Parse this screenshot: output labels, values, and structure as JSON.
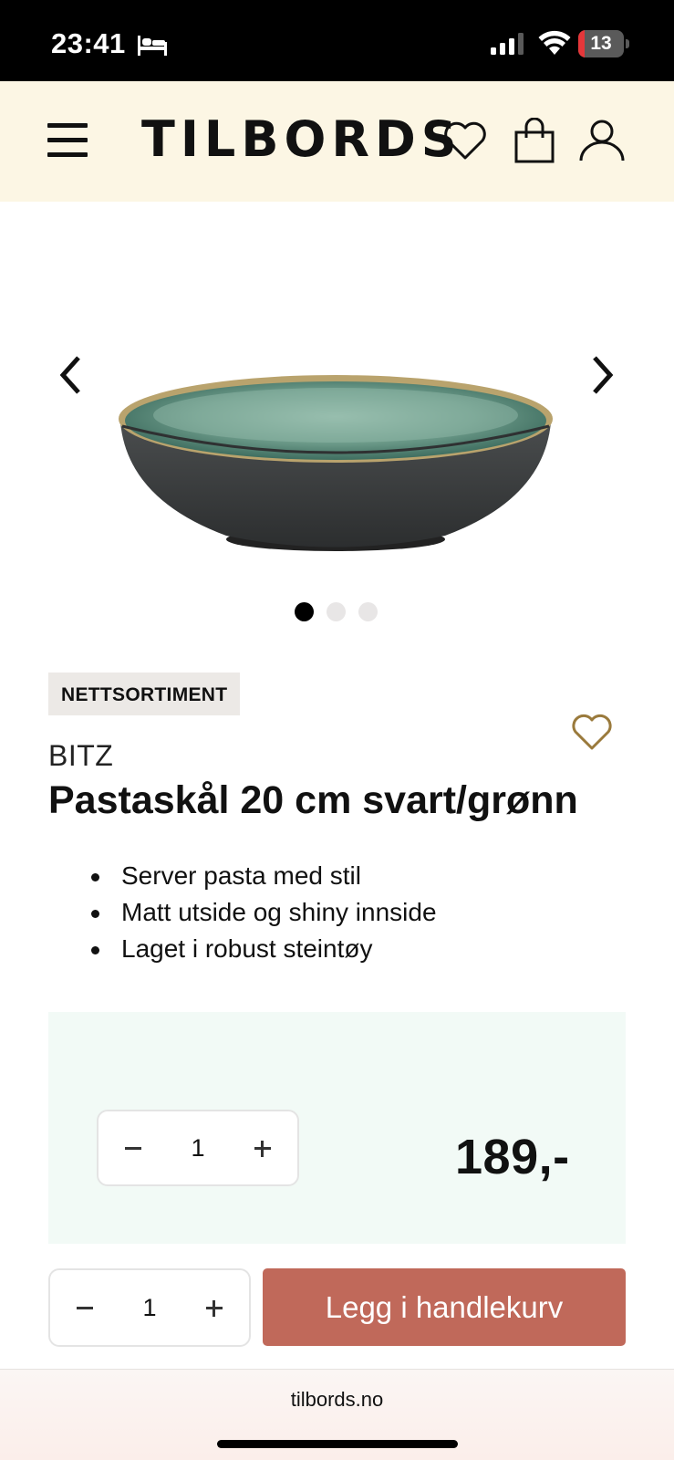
{
  "status_bar": {
    "time": "23:41",
    "battery_level": "13",
    "battery_fraction": 0.13,
    "icons": [
      "sleep-bed-icon",
      "cellular-signal-icon",
      "wifi-icon",
      "battery-icon"
    ]
  },
  "header": {
    "logo": "TILBORDS",
    "icons": [
      "hamburger-menu-icon",
      "heart-icon",
      "shopping-bag-icon",
      "user-icon"
    ]
  },
  "gallery": {
    "image_count": 3,
    "active_index": 0,
    "icons": [
      "chevron-left-icon",
      "chevron-right-icon"
    ]
  },
  "product": {
    "badge": "NETTSORTIMENT",
    "brand": "BITZ",
    "title": "Pastaskål 20 cm svart/grønn",
    "features": [
      "Server pasta med stil",
      "Matt utside og shiny innside",
      "Laget i robust steintøy"
    ],
    "price": "189,-",
    "quantity": "1"
  },
  "actions": {
    "quantity": "1",
    "add_to_cart_label": "Legg i handlekurv"
  },
  "browser": {
    "url": "tilbords.no"
  },
  "colors": {
    "header_bg": "#fcf6e4",
    "price_box_bg": "#f2faf6",
    "button_bg": "#c0695a",
    "wishlist_outline": "#9a7a3c",
    "battery_low": "#e5373a"
  }
}
